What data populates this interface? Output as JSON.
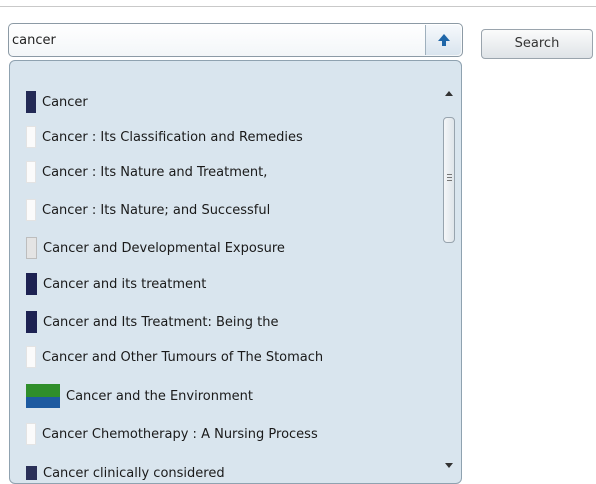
{
  "search": {
    "value": "cancer",
    "button_label": "Search",
    "toggle_icon": "up-arrow-icon"
  },
  "dropdown": {
    "items": [
      {
        "label": "Cancer",
        "thumb": "navy-cover"
      },
      {
        "label": "Cancer : Its Classification and Remedies",
        "thumb": "plain-page"
      },
      {
        "label": "Cancer : Its Nature and Treatment,",
        "thumb": "plain-page"
      },
      {
        "label": "Cancer : Its Nature; and Successful",
        "thumb": "plain-page"
      },
      {
        "label": "Cancer and Developmental Exposure",
        "thumb": "gray-cover"
      },
      {
        "label": "Cancer and its treatment",
        "thumb": "navy-cover"
      },
      {
        "label": "Cancer and Its Treatment: Being the",
        "thumb": "navy-cover"
      },
      {
        "label": "Cancer and Other Tumours of The Stomach",
        "thumb": "plain-page"
      },
      {
        "label": "Cancer and the Environment",
        "thumb": "green-blue-cover"
      },
      {
        "label": "Cancer Chemotherapy : A Nursing Process",
        "thumb": "plain-page"
      },
      {
        "label": "Cancer clinically considered",
        "thumb": "navy-cover"
      }
    ]
  }
}
